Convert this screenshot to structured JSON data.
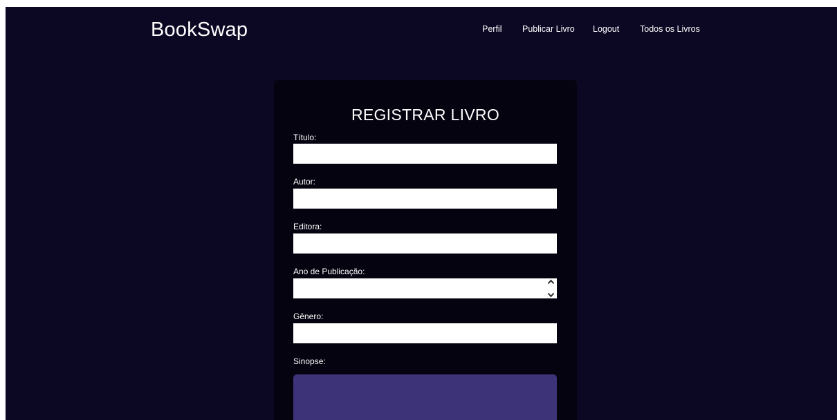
{
  "brand": "BookSwap",
  "nav": {
    "perfil": "Perfil",
    "publicar": "Publicar Livro",
    "logout": "Logout",
    "todos": "Todos os Livros"
  },
  "form": {
    "title": "REGISTRAR LIVRO",
    "fields": {
      "titulo": "Título:",
      "autor": "Autor:",
      "editora": "Editora:",
      "ano": "Ano de Publicação:",
      "genero": "Gênero:",
      "sinopse": "Sinopse:"
    }
  },
  "colors": {
    "background": "#0c0723",
    "card": "#05030f",
    "textarea": "#3d3379"
  }
}
